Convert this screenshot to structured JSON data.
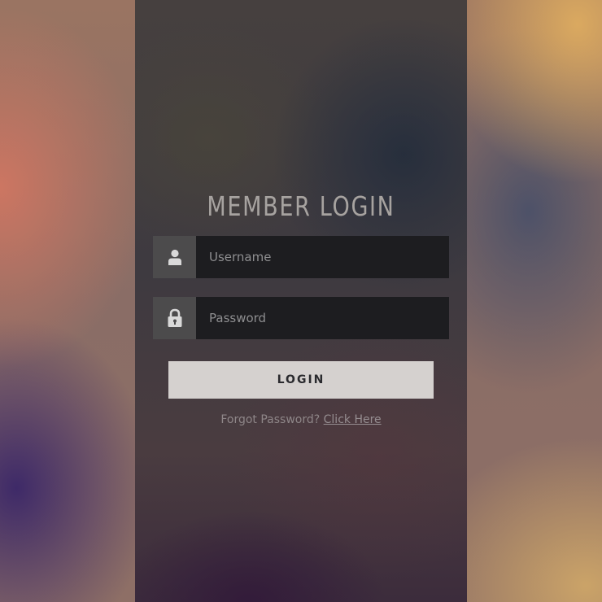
{
  "login_form": {
    "title": "MEMBER LOGIN",
    "username": {
      "placeholder": "Username",
      "value": "",
      "icon": "user-icon"
    },
    "password": {
      "placeholder": "Password",
      "value": "",
      "icon": "lock-icon"
    },
    "login_button_label": "LOGIN",
    "forgot_text": "Forgot Password?",
    "forgot_link_label": "Click Here"
  },
  "colors": {
    "panel": "#3e3a40",
    "icon_box": "#4c4b4c",
    "input_bg": "#1d1d20",
    "button_bg": "#d5d1cf",
    "title_text": "#a7a3a0"
  }
}
